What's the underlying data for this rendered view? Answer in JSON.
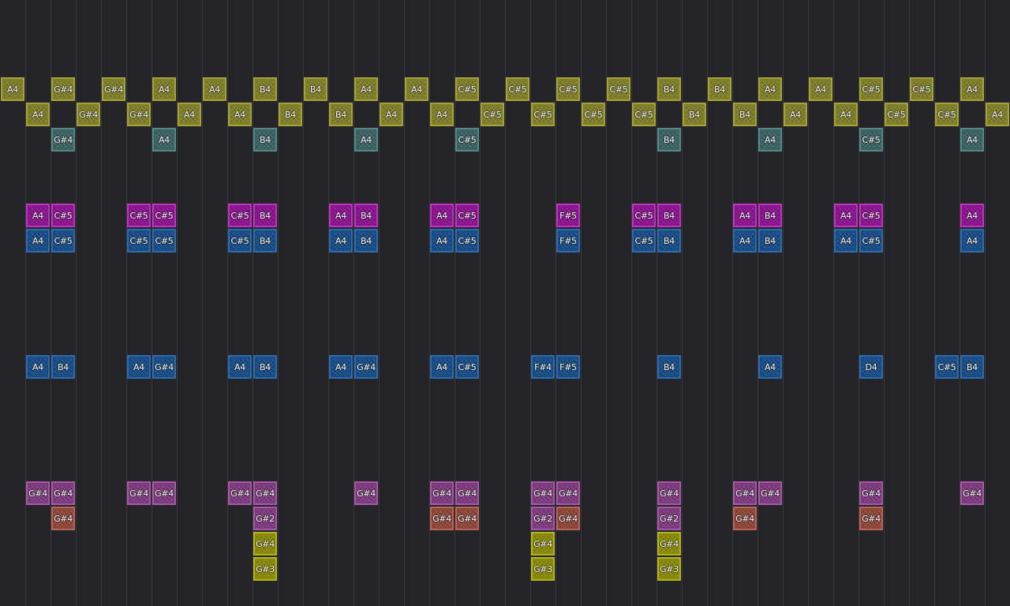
{
  "palette": {
    "olive": {
      "fill": "#7f7f28",
      "border": "#a4a43c"
    },
    "teal": {
      "fill": "#3b6262",
      "border": "#578a86"
    },
    "magenta": {
      "fill": "#8c1291",
      "border": "#b43ab9"
    },
    "blue": {
      "fill": "#174c86",
      "border": "#2e6cae"
    },
    "mauve": {
      "fill": "#7e3a7e",
      "border": "#a45aa4"
    },
    "salmon": {
      "fill": "#8e4638",
      "border": "#b8665a"
    },
    "yellow": {
      "fill": "#8a8a08",
      "border": "#b4b420"
    }
  },
  "notes": [
    {
      "col": 0,
      "row": 0,
      "label": "A4",
      "color": "olive"
    },
    {
      "col": 2,
      "row": 0,
      "label": "G#4",
      "color": "olive"
    },
    {
      "col": 4,
      "row": 0,
      "label": "G#4",
      "color": "olive"
    },
    {
      "col": 6,
      "row": 0,
      "label": "A4",
      "color": "olive"
    },
    {
      "col": 8,
      "row": 0,
      "label": "A4",
      "color": "olive"
    },
    {
      "col": 10,
      "row": 0,
      "label": "B4",
      "color": "olive"
    },
    {
      "col": 12,
      "row": 0,
      "label": "B4",
      "color": "olive"
    },
    {
      "col": 14,
      "row": 0,
      "label": "A4",
      "color": "olive"
    },
    {
      "col": 16,
      "row": 0,
      "label": "A4",
      "color": "olive"
    },
    {
      "col": 18,
      "row": 0,
      "label": "C#5",
      "color": "olive"
    },
    {
      "col": 20,
      "row": 0,
      "label": "C#5",
      "color": "olive"
    },
    {
      "col": 22,
      "row": 0,
      "label": "C#5",
      "color": "olive"
    },
    {
      "col": 24,
      "row": 0,
      "label": "C#5",
      "color": "olive"
    },
    {
      "col": 26,
      "row": 0,
      "label": "B4",
      "color": "olive"
    },
    {
      "col": 28,
      "row": 0,
      "label": "B4",
      "color": "olive"
    },
    {
      "col": 30,
      "row": 0,
      "label": "A4",
      "color": "olive"
    },
    {
      "col": 32,
      "row": 0,
      "label": "A4",
      "color": "olive"
    },
    {
      "col": 34,
      "row": 0,
      "label": "C#5",
      "color": "olive"
    },
    {
      "col": 36,
      "row": 0,
      "label": "C#5",
      "color": "olive"
    },
    {
      "col": 38,
      "row": 0,
      "label": "A4",
      "color": "olive"
    },
    {
      "col": 1,
      "row": 1,
      "label": "A4",
      "color": "olive"
    },
    {
      "col": 3,
      "row": 1,
      "label": "G#4",
      "color": "olive"
    },
    {
      "col": 5,
      "row": 1,
      "label": "G#4",
      "color": "olive"
    },
    {
      "col": 7,
      "row": 1,
      "label": "A4",
      "color": "olive"
    },
    {
      "col": 9,
      "row": 1,
      "label": "A4",
      "color": "olive"
    },
    {
      "col": 11,
      "row": 1,
      "label": "B4",
      "color": "olive"
    },
    {
      "col": 13,
      "row": 1,
      "label": "B4",
      "color": "olive"
    },
    {
      "col": 15,
      "row": 1,
      "label": "A4",
      "color": "olive"
    },
    {
      "col": 17,
      "row": 1,
      "label": "A4",
      "color": "olive"
    },
    {
      "col": 19,
      "row": 1,
      "label": "C#5",
      "color": "olive"
    },
    {
      "col": 21,
      "row": 1,
      "label": "C#5",
      "color": "olive"
    },
    {
      "col": 23,
      "row": 1,
      "label": "C#5",
      "color": "olive"
    },
    {
      "col": 25,
      "row": 1,
      "label": "C#5",
      "color": "olive"
    },
    {
      "col": 27,
      "row": 1,
      "label": "B4",
      "color": "olive"
    },
    {
      "col": 29,
      "row": 1,
      "label": "B4",
      "color": "olive"
    },
    {
      "col": 31,
      "row": 1,
      "label": "A4",
      "color": "olive"
    },
    {
      "col": 33,
      "row": 1,
      "label": "A4",
      "color": "olive"
    },
    {
      "col": 35,
      "row": 1,
      "label": "C#5",
      "color": "olive"
    },
    {
      "col": 37,
      "row": 1,
      "label": "C#5",
      "color": "olive"
    },
    {
      "col": 39,
      "row": 1,
      "label": "A4",
      "color": "olive"
    },
    {
      "col": 2,
      "row": 2,
      "label": "G#4",
      "color": "teal"
    },
    {
      "col": 6,
      "row": 2,
      "label": "A4",
      "color": "teal"
    },
    {
      "col": 10,
      "row": 2,
      "label": "B4",
      "color": "teal"
    },
    {
      "col": 14,
      "row": 2,
      "label": "A4",
      "color": "teal"
    },
    {
      "col": 18,
      "row": 2,
      "label": "C#5",
      "color": "teal"
    },
    {
      "col": 26,
      "row": 2,
      "label": "B4",
      "color": "teal"
    },
    {
      "col": 30,
      "row": 2,
      "label": "A4",
      "color": "teal"
    },
    {
      "col": 34,
      "row": 2,
      "label": "C#5",
      "color": "teal"
    },
    {
      "col": 38,
      "row": 2,
      "label": "A4",
      "color": "teal"
    },
    {
      "col": 1,
      "row": 5,
      "label": "A4",
      "color": "magenta"
    },
    {
      "col": 2,
      "row": 5,
      "label": "C#5",
      "color": "magenta"
    },
    {
      "col": 5,
      "row": 5,
      "label": "C#5",
      "color": "magenta"
    },
    {
      "col": 6,
      "row": 5,
      "label": "C#5",
      "color": "magenta"
    },
    {
      "col": 9,
      "row": 5,
      "label": "C#5",
      "color": "magenta"
    },
    {
      "col": 10,
      "row": 5,
      "label": "B4",
      "color": "magenta"
    },
    {
      "col": 13,
      "row": 5,
      "label": "A4",
      "color": "magenta"
    },
    {
      "col": 14,
      "row": 5,
      "label": "B4",
      "color": "magenta"
    },
    {
      "col": 17,
      "row": 5,
      "label": "A4",
      "color": "magenta"
    },
    {
      "col": 18,
      "row": 5,
      "label": "C#5",
      "color": "magenta"
    },
    {
      "col": 22,
      "row": 5,
      "label": "F#5",
      "color": "magenta"
    },
    {
      "col": 25,
      "row": 5,
      "label": "C#5",
      "color": "magenta"
    },
    {
      "col": 26,
      "row": 5,
      "label": "B4",
      "color": "magenta"
    },
    {
      "col": 29,
      "row": 5,
      "label": "A4",
      "color": "magenta"
    },
    {
      "col": 30,
      "row": 5,
      "label": "B4",
      "color": "magenta"
    },
    {
      "col": 33,
      "row": 5,
      "label": "A4",
      "color": "magenta"
    },
    {
      "col": 34,
      "row": 5,
      "label": "C#5",
      "color": "magenta"
    },
    {
      "col": 38,
      "row": 5,
      "label": "A4",
      "color": "magenta"
    },
    {
      "col": 1,
      "row": 6,
      "label": "A4",
      "color": "blue"
    },
    {
      "col": 2,
      "row": 6,
      "label": "C#5",
      "color": "blue"
    },
    {
      "col": 5,
      "row": 6,
      "label": "C#5",
      "color": "blue"
    },
    {
      "col": 6,
      "row": 6,
      "label": "C#5",
      "color": "blue"
    },
    {
      "col": 9,
      "row": 6,
      "label": "C#5",
      "color": "blue"
    },
    {
      "col": 10,
      "row": 6,
      "label": "B4",
      "color": "blue"
    },
    {
      "col": 13,
      "row": 6,
      "label": "A4",
      "color": "blue"
    },
    {
      "col": 14,
      "row": 6,
      "label": "B4",
      "color": "blue"
    },
    {
      "col": 17,
      "row": 6,
      "label": "A4",
      "color": "blue"
    },
    {
      "col": 18,
      "row": 6,
      "label": "C#5",
      "color": "blue"
    },
    {
      "col": 22,
      "row": 6,
      "label": "F#5",
      "color": "blue"
    },
    {
      "col": 25,
      "row": 6,
      "label": "C#5",
      "color": "blue"
    },
    {
      "col": 26,
      "row": 6,
      "label": "B4",
      "color": "blue"
    },
    {
      "col": 29,
      "row": 6,
      "label": "A4",
      "color": "blue"
    },
    {
      "col": 30,
      "row": 6,
      "label": "B4",
      "color": "blue"
    },
    {
      "col": 33,
      "row": 6,
      "label": "A4",
      "color": "blue"
    },
    {
      "col": 34,
      "row": 6,
      "label": "C#5",
      "color": "blue"
    },
    {
      "col": 38,
      "row": 6,
      "label": "A4",
      "color": "blue"
    },
    {
      "col": 1,
      "row": 11,
      "label": "A4",
      "color": "blue"
    },
    {
      "col": 2,
      "row": 11,
      "label": "B4",
      "color": "blue"
    },
    {
      "col": 5,
      "row": 11,
      "label": "A4",
      "color": "blue"
    },
    {
      "col": 6,
      "row": 11,
      "label": "G#4",
      "color": "blue"
    },
    {
      "col": 9,
      "row": 11,
      "label": "A4",
      "color": "blue"
    },
    {
      "col": 10,
      "row": 11,
      "label": "B4",
      "color": "blue"
    },
    {
      "col": 13,
      "row": 11,
      "label": "A4",
      "color": "blue"
    },
    {
      "col": 14,
      "row": 11,
      "label": "G#4",
      "color": "blue"
    },
    {
      "col": 17,
      "row": 11,
      "label": "A4",
      "color": "blue"
    },
    {
      "col": 18,
      "row": 11,
      "label": "C#5",
      "color": "blue"
    },
    {
      "col": 21,
      "row": 11,
      "label": "F#4",
      "color": "blue"
    },
    {
      "col": 22,
      "row": 11,
      "label": "F#5",
      "color": "blue"
    },
    {
      "col": 26,
      "row": 11,
      "label": "B4",
      "color": "blue"
    },
    {
      "col": 30,
      "row": 11,
      "label": "A4",
      "color": "blue"
    },
    {
      "col": 34,
      "row": 11,
      "label": "D4",
      "color": "blue"
    },
    {
      "col": 37,
      "row": 11,
      "label": "C#5",
      "color": "blue"
    },
    {
      "col": 38,
      "row": 11,
      "label": "B4",
      "color": "blue"
    },
    {
      "col": 1,
      "row": 16,
      "label": "G#4",
      "color": "mauve"
    },
    {
      "col": 2,
      "row": 16,
      "label": "G#4",
      "color": "mauve"
    },
    {
      "col": 5,
      "row": 16,
      "label": "G#4",
      "color": "mauve"
    },
    {
      "col": 6,
      "row": 16,
      "label": "G#4",
      "color": "mauve"
    },
    {
      "col": 9,
      "row": 16,
      "label": "G#4",
      "color": "mauve"
    },
    {
      "col": 10,
      "row": 16,
      "label": "G#4",
      "color": "mauve"
    },
    {
      "col": 14,
      "row": 16,
      "label": "G#4",
      "color": "mauve"
    },
    {
      "col": 17,
      "row": 16,
      "label": "G#4",
      "color": "mauve"
    },
    {
      "col": 18,
      "row": 16,
      "label": "G#4",
      "color": "mauve"
    },
    {
      "col": 21,
      "row": 16,
      "label": "G#4",
      "color": "mauve"
    },
    {
      "col": 22,
      "row": 16,
      "label": "G#4",
      "color": "mauve"
    },
    {
      "col": 26,
      "row": 16,
      "label": "G#4",
      "color": "mauve"
    },
    {
      "col": 29,
      "row": 16,
      "label": "G#4",
      "color": "mauve"
    },
    {
      "col": 30,
      "row": 16,
      "label": "G#4",
      "color": "mauve"
    },
    {
      "col": 34,
      "row": 16,
      "label": "G#4",
      "color": "mauve"
    },
    {
      "col": 38,
      "row": 16,
      "label": "G#4",
      "color": "mauve"
    },
    {
      "col": 2,
      "row": 17,
      "label": "G#4",
      "color": "salmon"
    },
    {
      "col": 10,
      "row": 17,
      "label": "G#2",
      "color": "mauve"
    },
    {
      "col": 17,
      "row": 17,
      "label": "G#4",
      "color": "salmon"
    },
    {
      "col": 18,
      "row": 17,
      "label": "G#4",
      "color": "salmon"
    },
    {
      "col": 21,
      "row": 17,
      "label": "G#2",
      "color": "mauve"
    },
    {
      "col": 22,
      "row": 17,
      "label": "G#4",
      "color": "salmon"
    },
    {
      "col": 26,
      "row": 17,
      "label": "G#2",
      "color": "mauve"
    },
    {
      "col": 29,
      "row": 17,
      "label": "G#4",
      "color": "salmon"
    },
    {
      "col": 34,
      "row": 17,
      "label": "G#4",
      "color": "salmon"
    },
    {
      "col": 10,
      "row": 18,
      "label": "G#4",
      "color": "yellow"
    },
    {
      "col": 21,
      "row": 18,
      "label": "G#4",
      "color": "yellow"
    },
    {
      "col": 26,
      "row": 18,
      "label": "G#4",
      "color": "yellow"
    },
    {
      "col": 10,
      "row": 19,
      "label": "G#3",
      "color": "yellow"
    },
    {
      "col": 21,
      "row": 19,
      "label": "G#3",
      "color": "yellow"
    },
    {
      "col": 26,
      "row": 19,
      "label": "G#3",
      "color": "yellow"
    }
  ]
}
